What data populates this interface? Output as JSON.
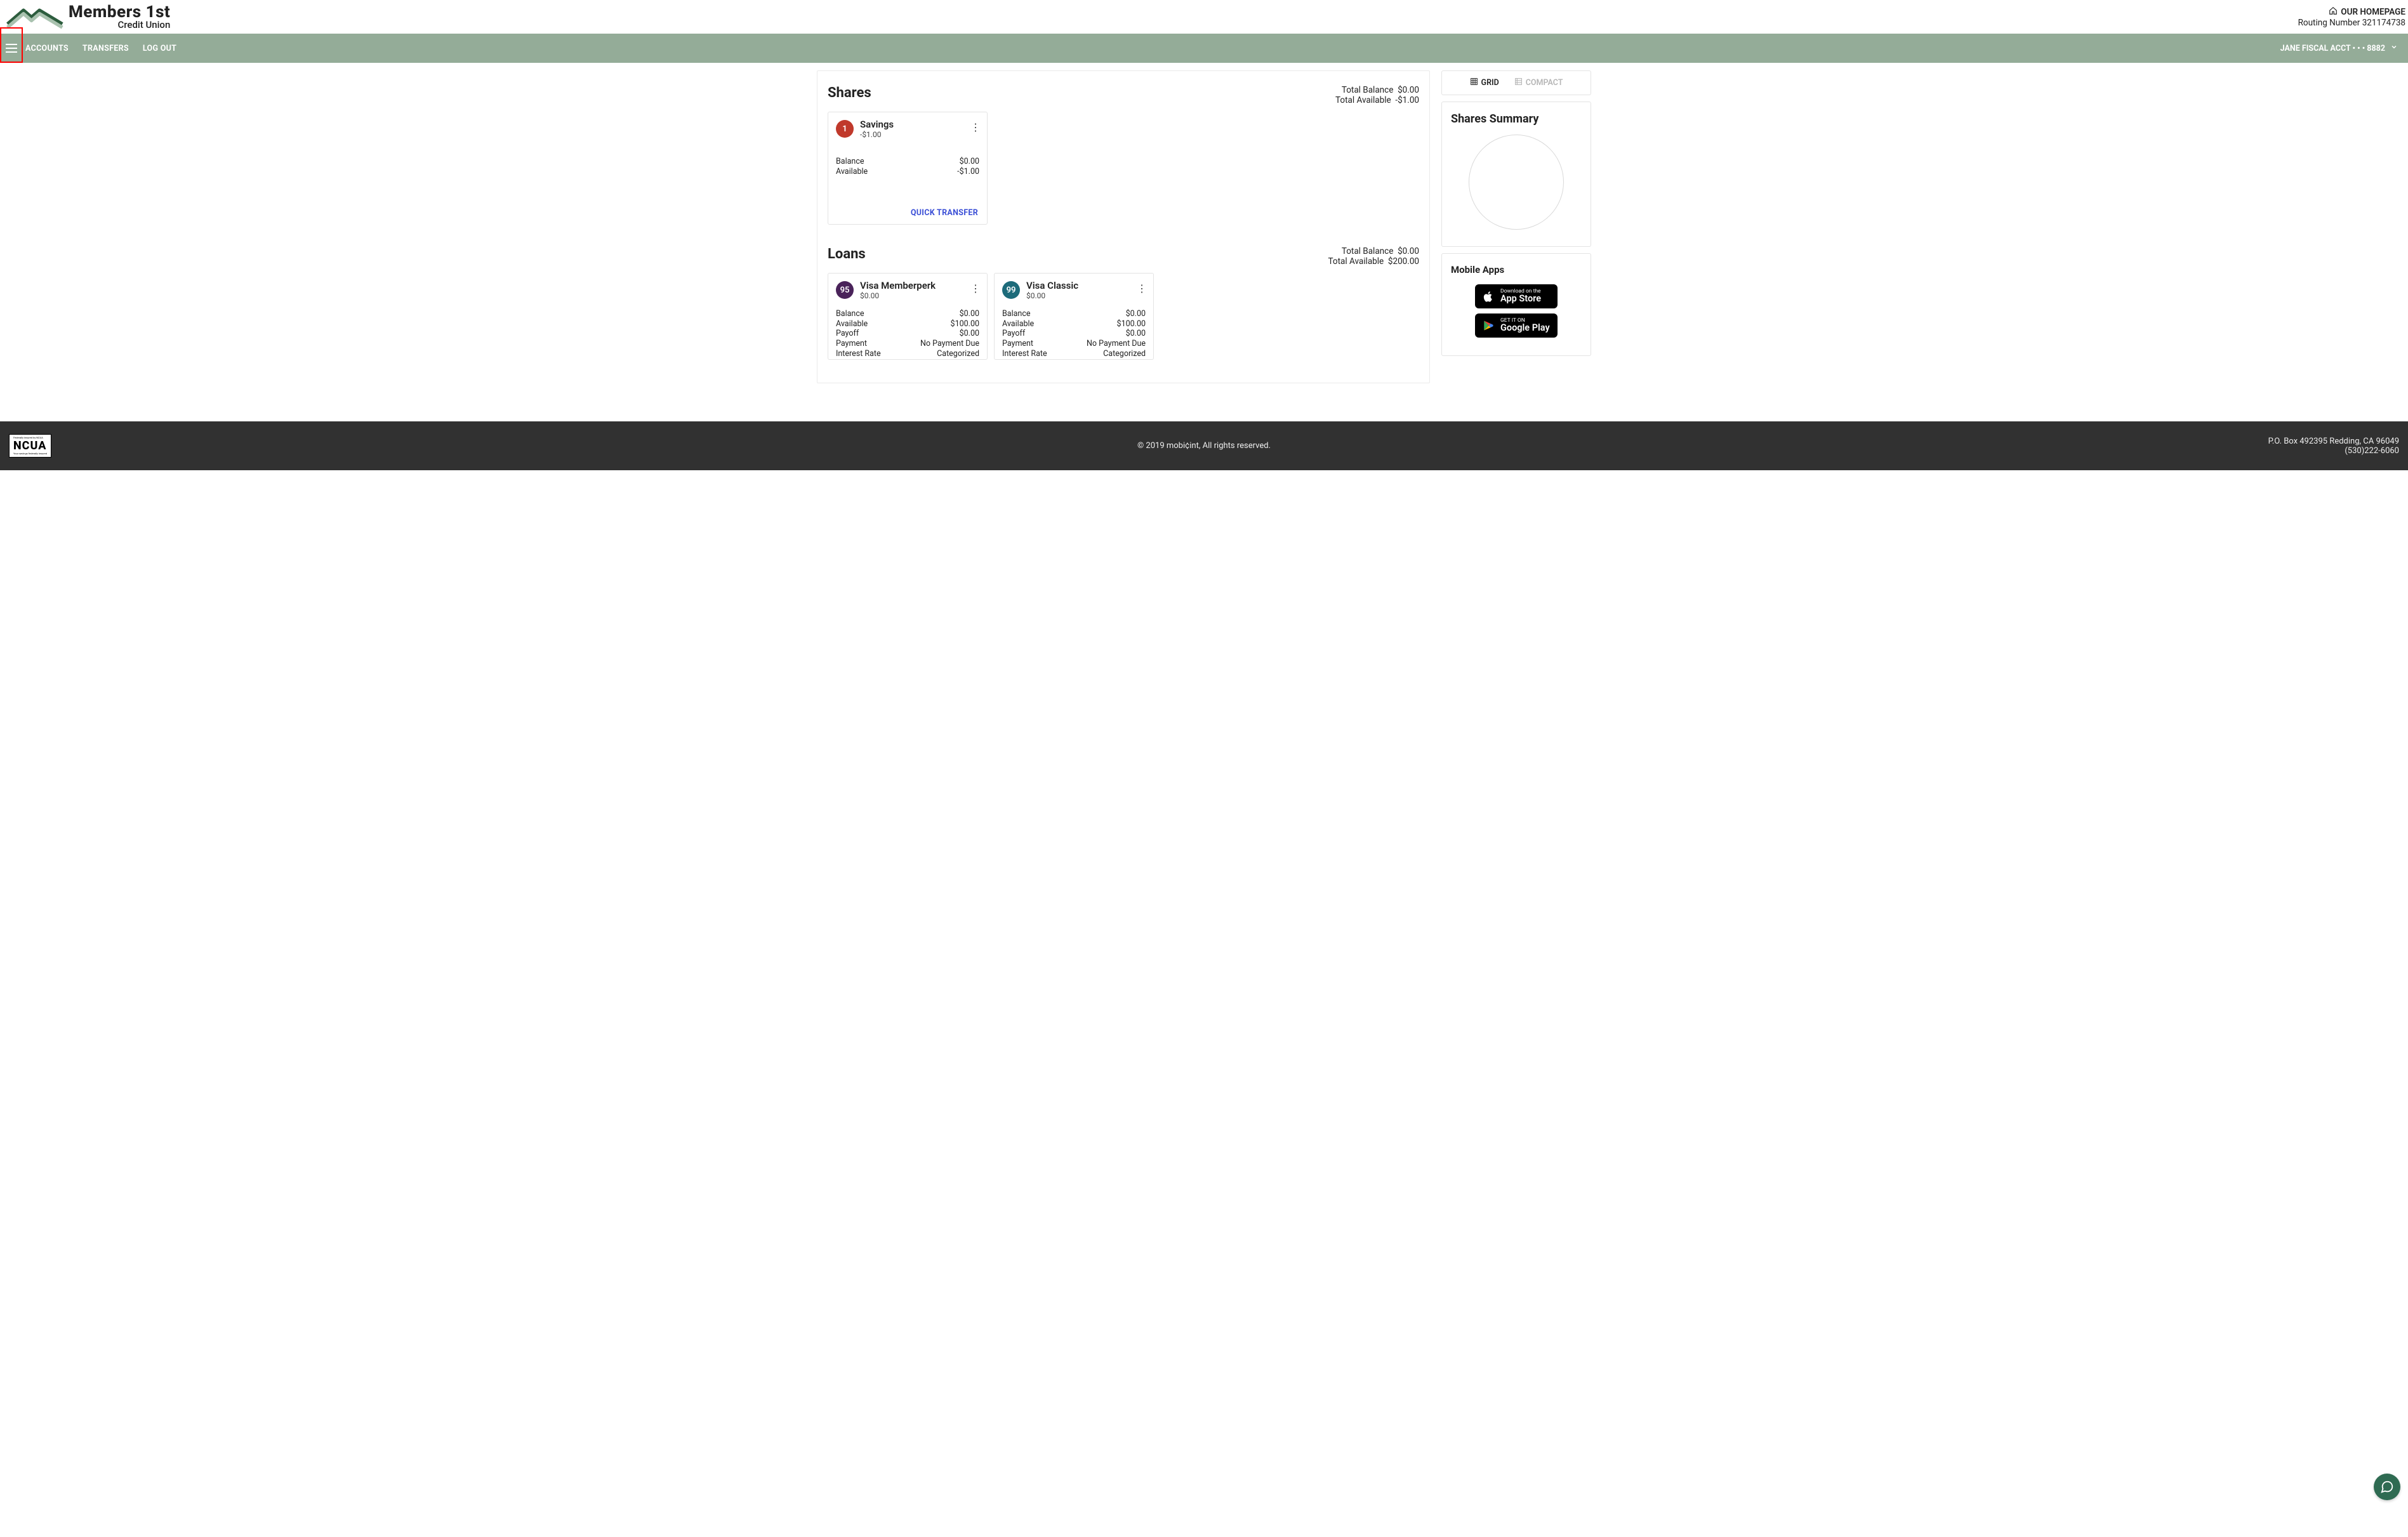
{
  "header": {
    "brand_line1": "Members 1st",
    "brand_line2": "Credit Union",
    "homepage_label": "OUR HOMEPAGE",
    "routing_label": "Routing Number 321174738"
  },
  "nav": {
    "links": [
      "ACCOUNTS",
      "TRANSFERS",
      "LOG OUT"
    ],
    "account_selector": "JANE FISCAL ACCT • • • 8882"
  },
  "shares": {
    "title": "Shares",
    "total_balance_label": "Total Balance",
    "total_balance_value": "$0.00",
    "total_available_label": "Total Available",
    "total_available_value": "-$1.00",
    "cards": [
      {
        "badge_num": "1",
        "name": "Savings",
        "subtitle": "-$1.00",
        "rows": [
          {
            "k": "Balance",
            "v": "$0.00"
          },
          {
            "k": "Available",
            "v": "-$1.00"
          }
        ],
        "quick_transfer": "QUICK TRANSFER"
      }
    ]
  },
  "loans": {
    "title": "Loans",
    "total_balance_label": "Total Balance",
    "total_balance_value": "$0.00",
    "total_available_label": "Total Available",
    "total_available_value": "$200.00",
    "cards": [
      {
        "badge_num": "95",
        "name": "Visa Memberperk",
        "subtitle": "$0.00",
        "rows": [
          {
            "k": "Balance",
            "v": "$0.00"
          },
          {
            "k": "Available",
            "v": "$100.00"
          },
          {
            "k": "Payoff",
            "v": "$0.00"
          },
          {
            "k": "Payment",
            "v": "No Payment Due"
          },
          {
            "k": "Interest Rate",
            "v": "Categorized"
          }
        ]
      },
      {
        "badge_num": "99",
        "name": "Visa Classic",
        "subtitle": "$0.00",
        "rows": [
          {
            "k": "Balance",
            "v": "$0.00"
          },
          {
            "k": "Available",
            "v": "$100.00"
          },
          {
            "k": "Payoff",
            "v": "$0.00"
          },
          {
            "k": "Payment",
            "v": "No Payment Due"
          },
          {
            "k": "Interest Rate",
            "v": "Categorized"
          }
        ]
      }
    ]
  },
  "side": {
    "view_grid": "GRID",
    "view_compact": "COMPACT",
    "summary_title": "Shares Summary",
    "mobile_title": "Mobile Apps",
    "appstore_small": "Download on the",
    "appstore_big": "App Store",
    "play_small": "GET IT ON",
    "play_big": "Google Play"
  },
  "footer": {
    "copyright": "© 2019 mobi¢int, All rights reserved.",
    "address": "P.O. Box 492395 Redding, CA 96049",
    "phone": "(530)222-6060",
    "ncua_label": "NCUA"
  }
}
